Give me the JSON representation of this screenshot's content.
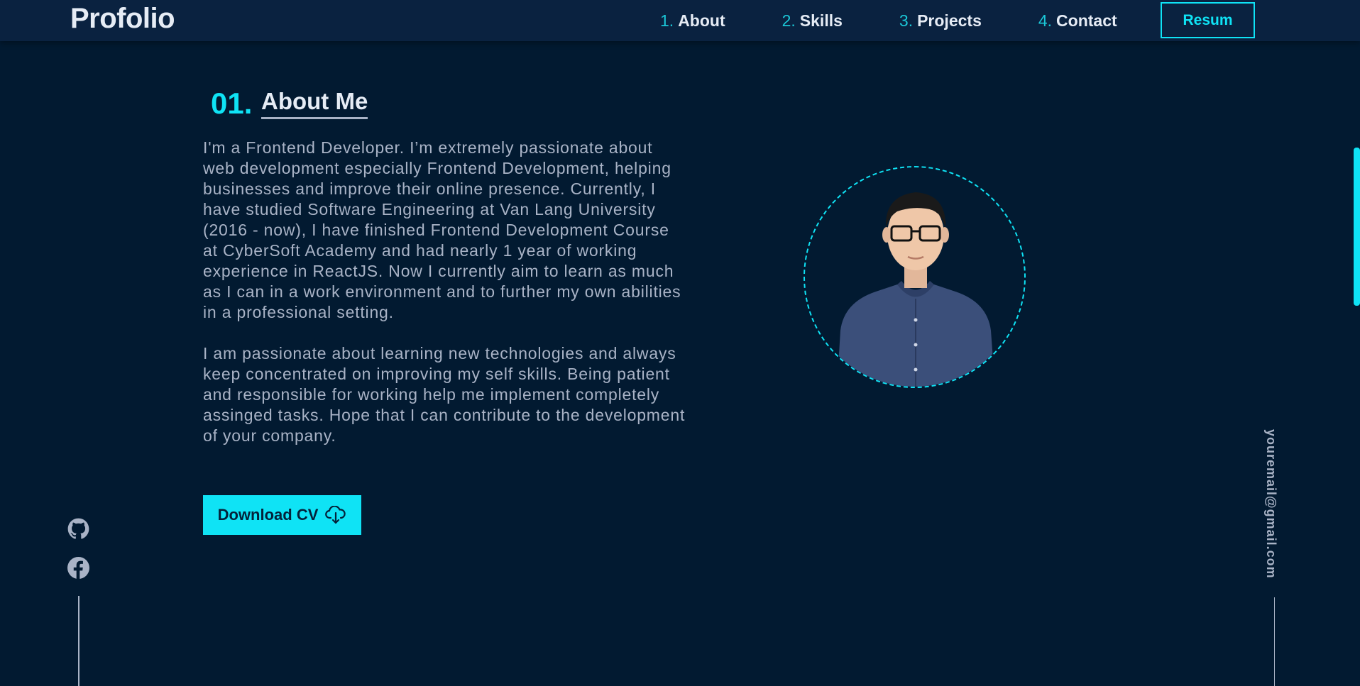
{
  "header": {
    "logo": "Profolio",
    "nav": [
      {
        "num": "1.",
        "label": "About"
      },
      {
        "num": "2.",
        "label": "Skills"
      },
      {
        "num": "3.",
        "label": "Projects"
      },
      {
        "num": "4.",
        "label": "Contact"
      }
    ],
    "resume_label": "Resum"
  },
  "about": {
    "number": "01.",
    "title": "About Me",
    "paragraphs": [
      "I'm a Frontend Developer. I’m extremely passionate about web development especially Frontend Development, helping businesses and improve their online presence. Currently, I have studied Software Engineering at Van Lang University (2016 - now), I have finished Frontend Development Course at CyberSoft Academy and had nearly 1 year of working experience in ReactJS. Now I currently aim to learn as much as I can in a work environment and to further my own abilities in a professional setting.",
      "I am passionate about learning new technologies and always keep concentrated on improving my self skills. Being patient and responsible for working help me implement completely assinged tasks. Hope that I can contribute to the development of your company."
    ],
    "download_label": "Download CV"
  },
  "social": {
    "icons": [
      "github-icon",
      "facebook-icon"
    ]
  },
  "email": "youremail@gmail.com",
  "colors": {
    "background": "#021a31",
    "navbar": "#0a2240",
    "accent": "#0fe3f5",
    "text": "#a9b3c6",
    "heading": "#e6ecf5"
  }
}
